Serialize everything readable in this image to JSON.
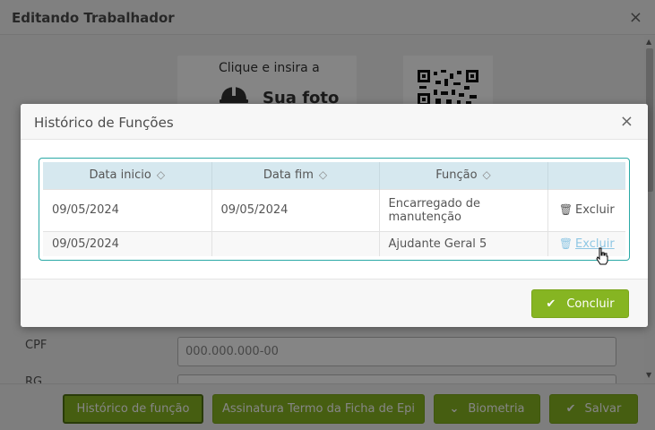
{
  "background": {
    "title": "Editando Trabalhador",
    "close_glyph": "×",
    "photo": {
      "line1": "Clique e insira a",
      "line2": "Sua foto",
      "icon": "helmet-icon"
    },
    "qr": {
      "icon": "qr-code-icon"
    },
    "cpf": {
      "label": "CPF",
      "value": "000.000.000-00"
    },
    "rg": {
      "label": "RG"
    }
  },
  "footer": {
    "historico": "Histórico de função",
    "assinatura": "Assinatura Termo da Ficha de Epi",
    "biometria": "Biometria",
    "salvar": "Salvar",
    "check_glyph": "✔"
  },
  "modal": {
    "title": "Histórico de Funções",
    "close_glyph": "×",
    "table": {
      "headers": [
        "Data inicio",
        "Data fim",
        "Função",
        ""
      ],
      "sort_glyph": "◇",
      "rows": [
        {
          "inicio": "09/05/2024",
          "fim": "09/05/2024",
          "funcao": "Encarregado de manutenção",
          "action": "Excluir"
        },
        {
          "inicio": "09/05/2024",
          "fim": "",
          "funcao": "Ajudante Geral 5",
          "action": "Excluir"
        }
      ]
    },
    "concluir": "Concluir"
  },
  "colors": {
    "accent_green": "#86b522",
    "table_border": "#2aa9a6",
    "header_bg": "#d6e8ef"
  }
}
